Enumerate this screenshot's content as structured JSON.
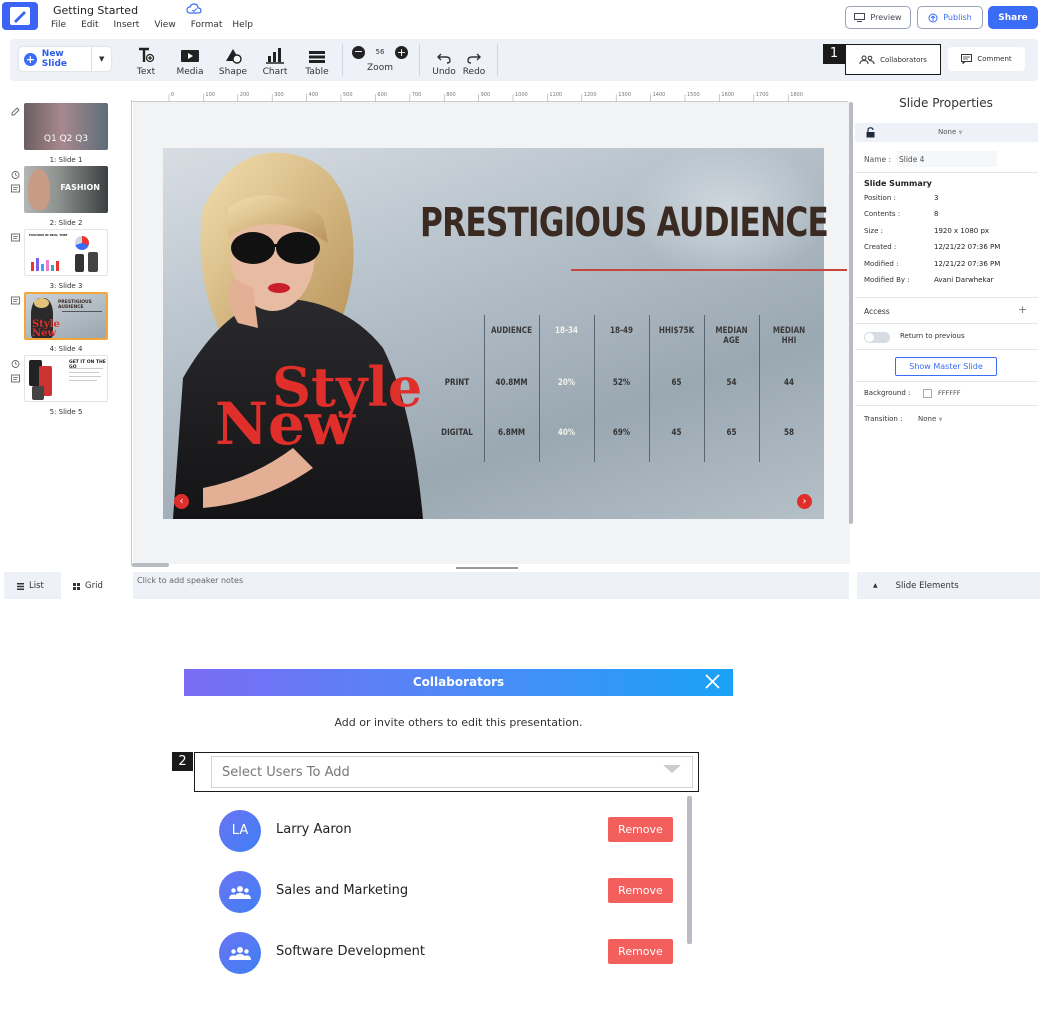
{
  "app": {
    "document_title": "Getting Started",
    "menu": [
      "File",
      "Edit",
      "Insert",
      "View",
      "Format",
      "Help"
    ],
    "preview_label": "Preview",
    "publish_label": "Publish",
    "share_label": "Share"
  },
  "toolbar": {
    "new_slide_label": "New Slide",
    "tools": [
      "Text",
      "Media",
      "Shape",
      "Chart",
      "Table"
    ],
    "zoom_value": "56",
    "zoom_label": "Zoom",
    "undo_label": "Undo",
    "redo_label": "Redo",
    "collaborators_label": "Collaborators",
    "comment_label": "Comment",
    "marker_1": "1"
  },
  "ruler": {
    "top_ticks": [
      "0",
      "100",
      "200",
      "300",
      "400",
      "500",
      "600",
      "700",
      "800",
      "900",
      "1000",
      "1100",
      "1200",
      "1300",
      "1400",
      "1500",
      "1600",
      "1700",
      "1800"
    ]
  },
  "slides_panel": {
    "thumbnails": [
      {
        "label": "1: Slide 1",
        "text": "Q1 Q2 Q3"
      },
      {
        "label": "2: Slide 2",
        "text": "FASHION"
      },
      {
        "label": "3: Slide 3",
        "text": "FASHION IN REAL TIME"
      },
      {
        "label": "4: Slide 4",
        "text": "PRESTIGIOUS AUDIENCE"
      },
      {
        "label": "5: Slide 5",
        "text": "GET IT ON THE GO"
      }
    ],
    "list_label": "List",
    "grid_label": "Grid"
  },
  "slide": {
    "title": "PRESTIGIOUS AUDIENCE",
    "logo_line1": "Style",
    "logo_line2": "New",
    "table": {
      "headers": [
        "AUDIENCE",
        "18-34",
        "18-49",
        "HHI$75K",
        "MEDIAN AGE",
        "MEDIAN HHI"
      ],
      "rows": [
        {
          "label": "PRINT",
          "values": [
            "40.8MM",
            "20%",
            "52%",
            "65",
            "54",
            "44"
          ]
        },
        {
          "label": "DIGITAL",
          "values": [
            "6.8MM",
            "40%",
            "69%",
            "45",
            "65",
            "58"
          ]
        }
      ]
    }
  },
  "notes": {
    "placeholder": "Click to add speaker notes"
  },
  "properties": {
    "title": "Slide Properties",
    "master_value": "None",
    "name_label": "Name :",
    "name_value": "Slide 4",
    "summary_title": "Slide Summary",
    "position_label": "Position :",
    "position_value": "3",
    "contents_label": "Contents :",
    "contents_value": "8",
    "size_label": "Size :",
    "size_value": "1920 x 1080 px",
    "created_label": "Created :",
    "created_value": "12/21/22 07:36 PM",
    "modified_label": "Modified :",
    "modified_value": "12/21/22 07:36 PM",
    "modified_by_label": "Modified By :",
    "modified_by_value": "Avani Darwhekar",
    "access_label": "Access",
    "return_label": "Return to previous",
    "show_master_label": "Show Master Slide",
    "background_label": "Background :",
    "background_value": "FFFFFF",
    "transition_label": "Transition :",
    "transition_value": "None",
    "slide_elements_label": "Slide Elements"
  },
  "collaborators_dialog": {
    "title": "Collaborators",
    "subtitle": "Add or invite others to edit this presentation.",
    "marker_2": "2",
    "select_placeholder": "Select Users To Add",
    "remove_label": "Remove",
    "users": [
      {
        "initials": "LA",
        "name": "Larry Aaron"
      },
      {
        "initials": "",
        "name": "Sales and Marketing"
      },
      {
        "initials": "",
        "name": "Software Development"
      }
    ]
  },
  "colors": {
    "brand_blue": "#3b6cf6",
    "remove_red": "#f25f5c",
    "slide_accent_red": "#e02f2a"
  }
}
